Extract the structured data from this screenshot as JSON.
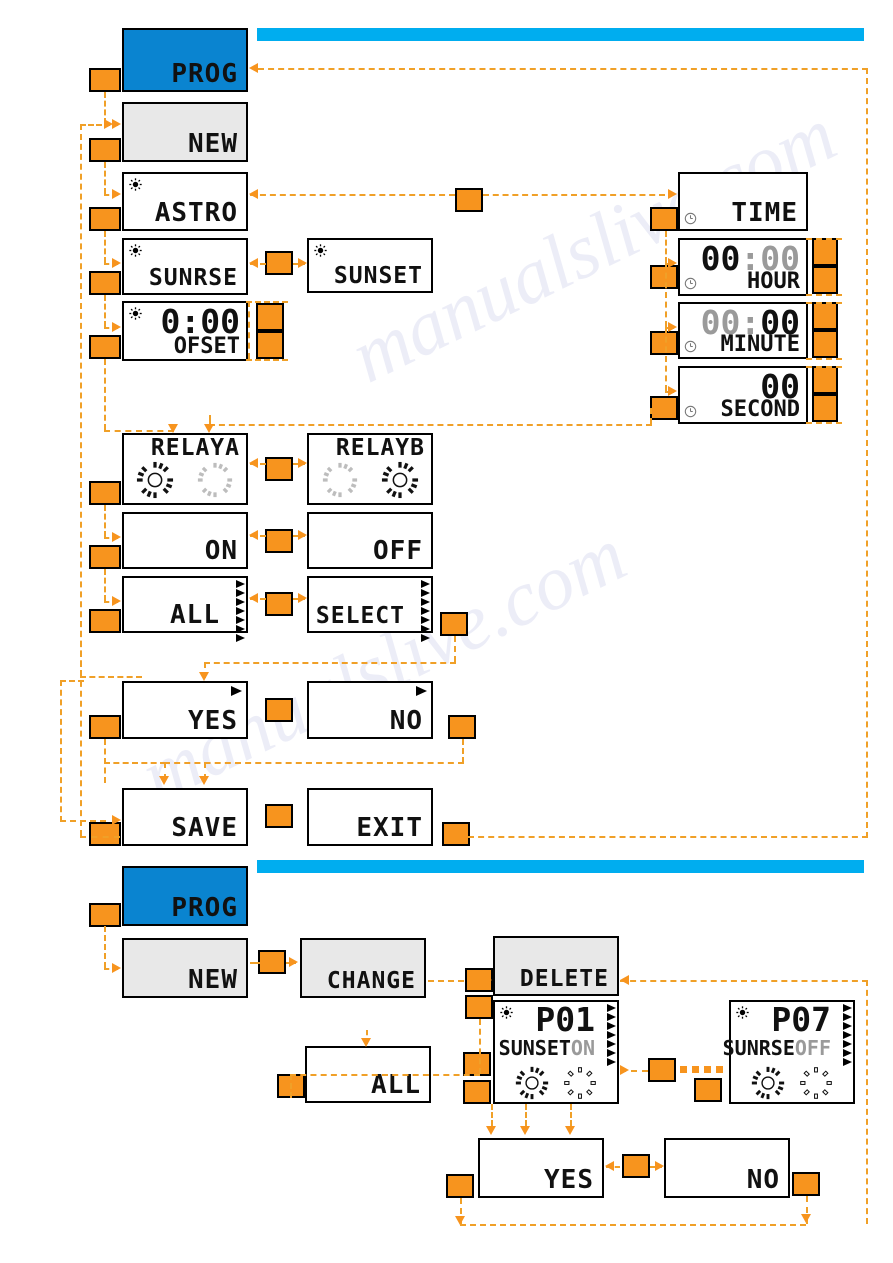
{
  "diagram": {
    "title": "Timer programming menu flowchart",
    "colors": {
      "prog_blue": "#0a84d0",
      "bar_cyan": "#00adef",
      "button_orange": "#f7941e",
      "menu_grey": "#e8e8e8",
      "lcd_dim": "#9a9a9a"
    },
    "watermark": "manualslive.com"
  },
  "section1": {
    "prog": "PROG",
    "new": "NEW",
    "astro": "ASTRO",
    "sunrise": "SUNRSE",
    "sunset": "SUNSET",
    "offset_value": "0:00",
    "offset_label": "OFSET",
    "time": "TIME",
    "hour_value_active": "00",
    "hour_value_dim": "00",
    "hour_label": "HOUR",
    "minute_value_dim": "00",
    "minute_value_active": "00",
    "minute_label": "MINUTE",
    "second_value": "00",
    "second_label": "SECOND",
    "colon": ":",
    "relay_a": "RELAYA",
    "relay_b": "RELAYB",
    "on": "ON",
    "off": "OFF",
    "all": "ALL",
    "select": "SELECT",
    "yes": "YES",
    "no": "NO",
    "save": "SAVE",
    "exit": "EXIT"
  },
  "section2": {
    "prog": "PROG",
    "new": "NEW",
    "change": "CHANGE",
    "delete": "DELETE",
    "all": "ALL",
    "p01_id": "P01",
    "p01_mode": "SUNSET",
    "p01_state": "ON",
    "p07_id": "P07",
    "p07_mode": "SUNRSE",
    "p07_state": "OFF",
    "yes": "YES",
    "no": "NO"
  },
  "icons": {
    "sun": "sun-icon",
    "clock": "clock-icon",
    "dial_active": "dial-active-icon",
    "dial_inactive": "dial-inactive-icon",
    "triangle_marker": "triangle-marker-icon"
  }
}
